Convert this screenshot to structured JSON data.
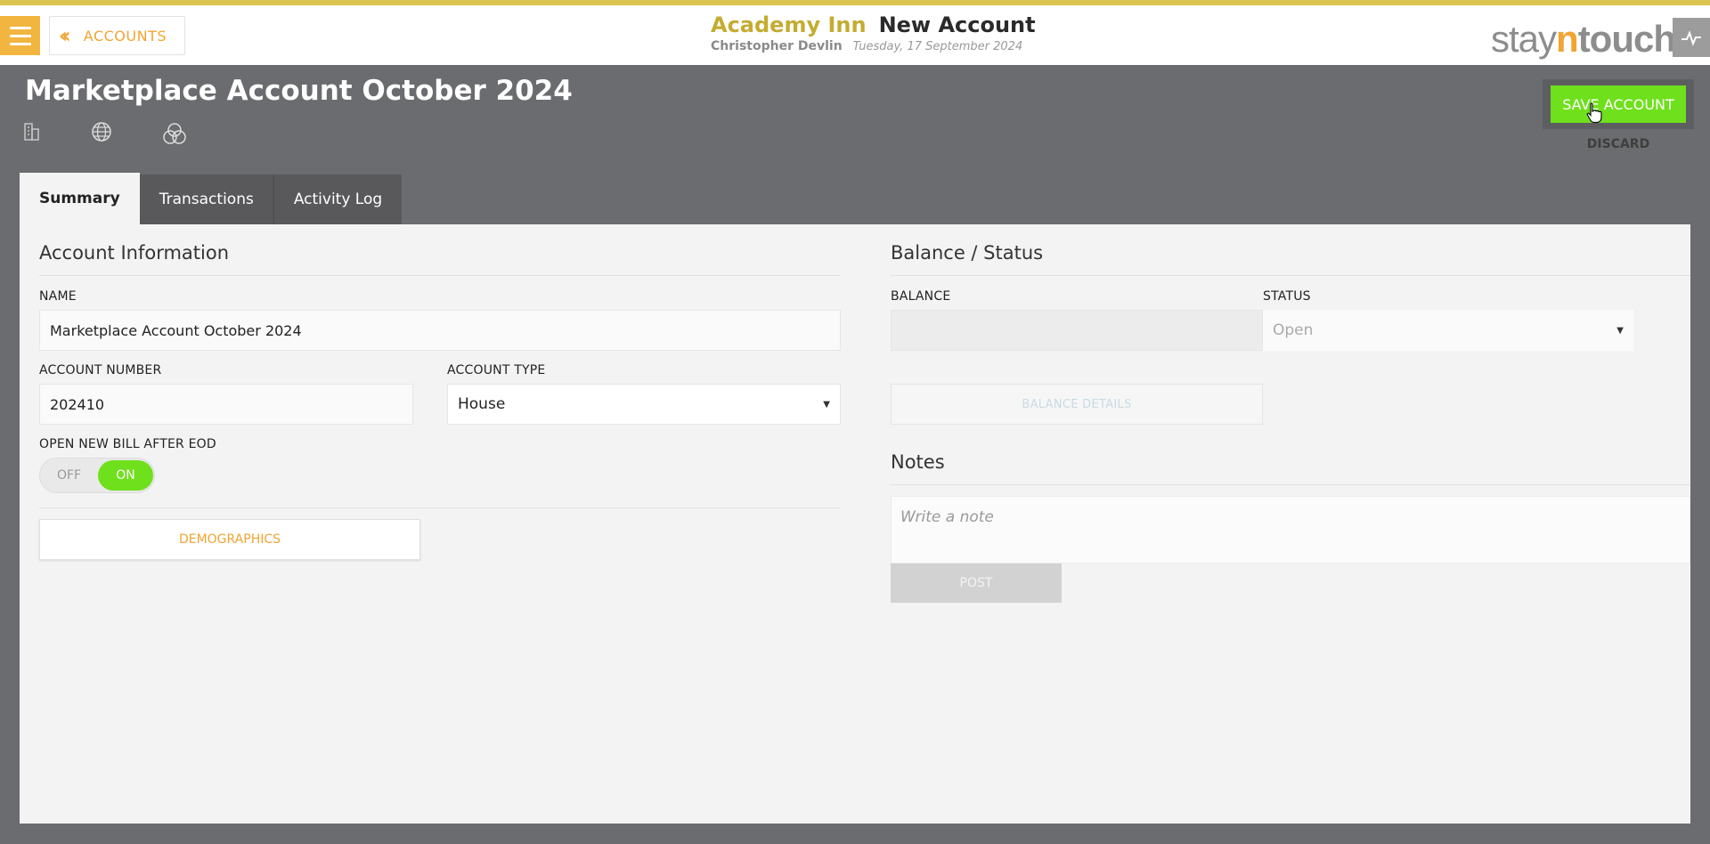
{
  "header": {
    "back_label": "ACCOUNTS",
    "hotel_name": "Academy Inn",
    "page_name": "New Account",
    "user_name": "Christopher Devlin",
    "date": "Tuesday, 17 September 2024",
    "logo": {
      "part1": "stay",
      "part2": "n",
      "part3": "touch"
    },
    "accent_color": "#f2a431",
    "top_bar_color": "#d9c44f"
  },
  "account": {
    "title": "Marketplace Account October 2024",
    "save_label": "SAVE ACCOUNT",
    "discard_label": "DISCARD",
    "icons": [
      "building-icon",
      "globe-icon",
      "overlapping-circles-icon"
    ]
  },
  "tabs": [
    {
      "label": "Summary",
      "active": true
    },
    {
      "label": "Transactions",
      "active": false
    },
    {
      "label": "Activity Log",
      "active": false
    }
  ],
  "account_info": {
    "section_title": "Account Information",
    "name_label": "NAME",
    "name_value": "Marketplace Account October 2024",
    "number_label": "ACCOUNT NUMBER",
    "number_value": "202410",
    "type_label": "ACCOUNT TYPE",
    "type_value": "House",
    "bill_label": "OPEN NEW BILL AFTER EOD",
    "toggle_off": "OFF",
    "toggle_on": "ON",
    "toggle_state": "on",
    "demographics_label": "DEMOGRAPHICS"
  },
  "balance": {
    "section_title": "Balance / Status",
    "balance_label": "BALANCE",
    "balance_value": "",
    "status_label": "STATUS",
    "status_value": "Open",
    "details_label": "BALANCE DETAILS"
  },
  "notes": {
    "section_title": "Notes",
    "placeholder": "Write a note",
    "post_label": "POST"
  },
  "colors": {
    "save_green": "#6fe01c",
    "background": "#6b6c6f",
    "panel": "#f3f3f3"
  }
}
